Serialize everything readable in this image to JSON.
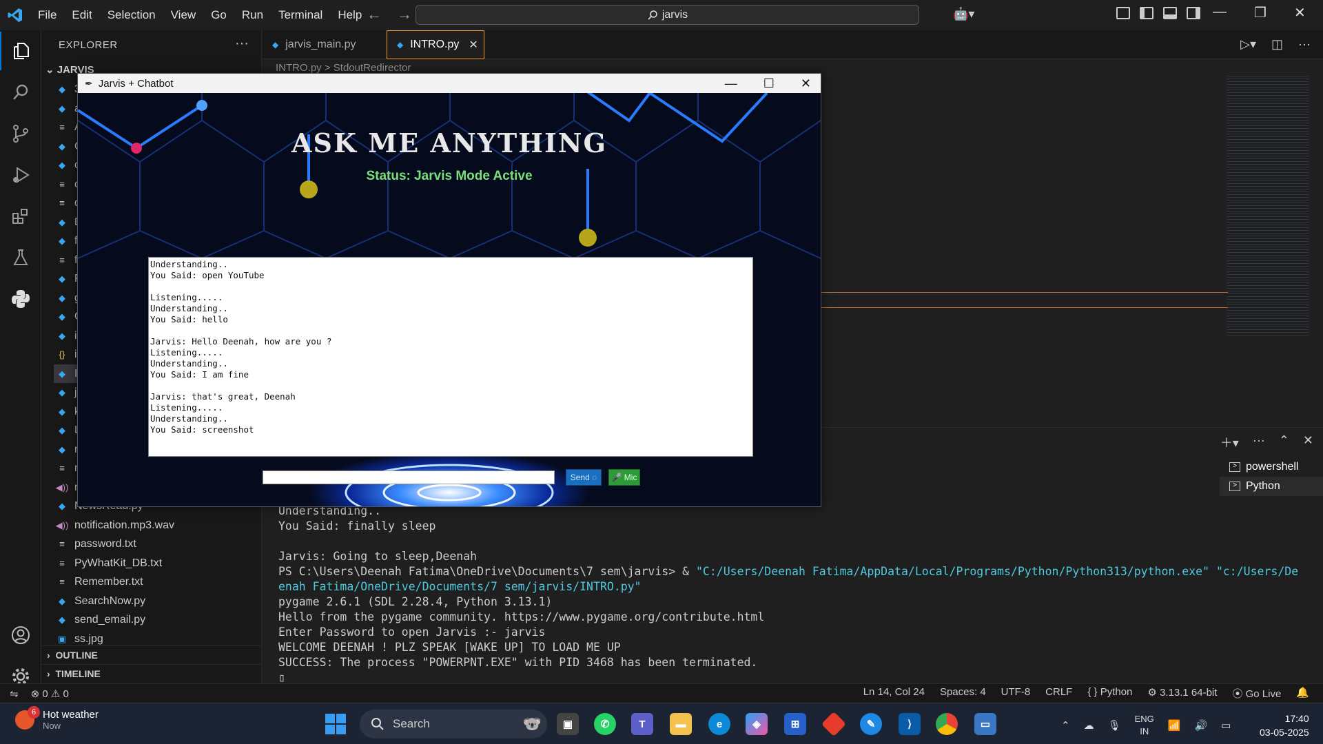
{
  "titlebar": {
    "menu": [
      "File",
      "Edit",
      "Selection",
      "View",
      "Go",
      "Run",
      "Terminal",
      "Help"
    ],
    "search": "jarvis"
  },
  "sidebar": {
    "header": "EXPLORER",
    "root": "JARVIS",
    "files_partial": [
      {
        "label": "3",
        "icon": "python-file-icon"
      },
      {
        "label": "a",
        "icon": "python-file-icon"
      },
      {
        "label": "A",
        "icon": "text-file-icon"
      },
      {
        "label": "C",
        "icon": "python-file-icon"
      },
      {
        "label": "c",
        "icon": "python-file-icon"
      },
      {
        "label": "c",
        "icon": "text-file-icon"
      },
      {
        "label": "d",
        "icon": "text-file-icon"
      },
      {
        "label": "D",
        "icon": "python-file-icon"
      },
      {
        "label": "fi",
        "icon": "python-file-icon"
      },
      {
        "label": "fo",
        "icon": "text-file-icon"
      },
      {
        "label": "F",
        "icon": "python-file-icon"
      },
      {
        "label": "g",
        "icon": "python-file-icon"
      },
      {
        "label": "G",
        "icon": "python-file-icon"
      },
      {
        "label": "ir",
        "icon": "python-file-icon"
      },
      {
        "label": "ir",
        "icon": "json-file-icon"
      },
      {
        "label": "IN",
        "icon": "python-file-icon"
      },
      {
        "label": "ja",
        "icon": "python-file-icon"
      },
      {
        "label": "k",
        "icon": "python-file-icon"
      },
      {
        "label": "L",
        "icon": "python-file-icon"
      },
      {
        "label": "m",
        "icon": "python-file-icon"
      },
      {
        "label": "m",
        "icon": "text-file-icon"
      },
      {
        "label": "m",
        "icon": "audio-file-icon"
      }
    ],
    "files": [
      {
        "label": "NewsRead.py",
        "icon": "python-file-icon"
      },
      {
        "label": "notification.mp3.wav",
        "icon": "audio-file-icon"
      },
      {
        "label": "password.txt",
        "icon": "text-file-icon"
      },
      {
        "label": "PyWhatKit_DB.txt",
        "icon": "text-file-icon"
      },
      {
        "label": "Remember.txt",
        "icon": "text-file-icon"
      },
      {
        "label": "SearchNow.py",
        "icon": "python-file-icon"
      },
      {
        "label": "send_email.py",
        "icon": "python-file-icon"
      },
      {
        "label": "ss.jpg",
        "icon": "image-file-icon"
      }
    ],
    "outline": "OUTLINE",
    "timeline": "TIMELINE"
  },
  "tabs": [
    {
      "label": "jarvis_main.py",
      "active": false
    },
    {
      "label": "INTRO.py",
      "active": true
    }
  ],
  "breadcrumb": "INTRO.py  >  StdoutRedirector",
  "terminal": {
    "lines": [
      "Understanding..",
      "You Said: finally sleep",
      "",
      "Jarvis: Going to sleep,Deenah",
      "PS C:\\Users\\Deenah Fatima\\OneDrive\\Documents\\7 sem\\jarvis> & ",
      "pygame 2.6.1 (SDL 2.28.4, Python 3.13.1)",
      "Hello from the pygame community. https://www.pygame.org/contribute.html",
      "Enter Password to open Jarvis :- jarvis",
      "WELCOME DEENAH ! PLZ SPEAK [WAKE UP] TO LOAD ME UP",
      "SUCCESS: The process \"POWERPNT.EXE\" with PID 3468 has been terminated."
    ],
    "cmd_part1": "\"C:/Users/Deenah Fatima/AppData/Local/Programs/Python/Python313/python.exe\" \"c:/Users/De",
    "cmd_part2": "enah Fatima/OneDrive/Documents/7 sem/jarvis/INTRO.py\"",
    "list": [
      "powershell",
      "Python"
    ]
  },
  "statusbar": {
    "errors": "0",
    "warnings": "0",
    "position": "Ln 14, Col 24",
    "spaces": "Spaces: 4",
    "encoding": "UTF-8",
    "eol": "CRLF",
    "language": "Python",
    "interpreter": "3.13.1 64-bit",
    "golive": "Go Live"
  },
  "jarvis": {
    "title": "Jarvis + Chatbot",
    "heading": "ASK ME ANYTHING",
    "status": "Status: Jarvis Mode Active",
    "log": "Understanding..\nYou Said: open YouTube\n\nListening.....\nUnderstanding..\nYou Said: hello\n\nJarvis: Hello Deenah, how are you ?\nListening.....\nUnderstanding..\nYou Said: I am fine\n\nJarvis: that's great, Deenah\nListening.....\nUnderstanding..\nYou Said: screenshot",
    "send": "Send ◌",
    "mic": "🎤 Mic"
  },
  "taskbar": {
    "weather_title": "Hot weather",
    "weather_sub": "Now",
    "weather_badge": "6",
    "search": "Search",
    "lang1": "ENG",
    "lang2": "IN",
    "time": "17:40",
    "date": "03-05-2025"
  }
}
